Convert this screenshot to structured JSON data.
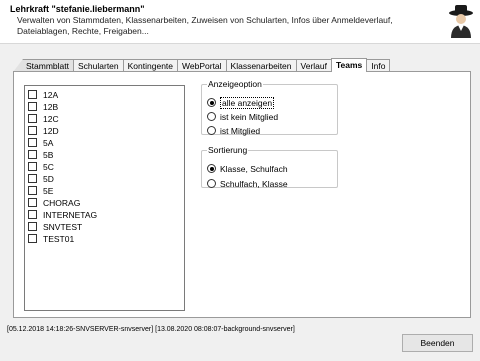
{
  "header": {
    "title": "Lehrkraft \"stefanie.liebermann\"",
    "description": "Verwalten von Stammdaten, Klassenarbeiten, Zuweisen von Schularten, Infos über Anmeldeverlauf, Dateiablagen, Rechte, Freigaben..."
  },
  "tabs": [
    {
      "label": "Stammblatt"
    },
    {
      "label": "Schularten"
    },
    {
      "label": "Kontingente"
    },
    {
      "label": "WebPortal"
    },
    {
      "label": "Klassenarbeiten"
    },
    {
      "label": "Verlauf"
    },
    {
      "label": "Teams",
      "active": true
    },
    {
      "label": "Info"
    }
  ],
  "team_list": [
    {
      "label": "12A",
      "checked": false
    },
    {
      "label": "12B",
      "checked": false
    },
    {
      "label": "12C",
      "checked": false
    },
    {
      "label": "12D",
      "checked": false
    },
    {
      "label": "5A",
      "checked": false
    },
    {
      "label": "5B",
      "checked": false
    },
    {
      "label": "5C",
      "checked": false
    },
    {
      "label": "5D",
      "checked": false
    },
    {
      "label": "5E",
      "checked": false
    },
    {
      "label": "CHORAG",
      "checked": false
    },
    {
      "label": "INTERNETAG",
      "checked": false
    },
    {
      "label": "SNVTEST",
      "checked": false
    },
    {
      "label": "TEST01",
      "checked": false
    }
  ],
  "display_option": {
    "legend": "Anzeigeoption",
    "options": [
      {
        "label": "alle anzeigen",
        "selected": true
      },
      {
        "label": "ist kein Mitglied",
        "selected": false
      },
      {
        "label": "ist  Mitglied",
        "selected": false
      }
    ]
  },
  "sorting": {
    "legend": "Sortierung",
    "options": [
      {
        "label": "Klasse, Schulfach",
        "selected": true
      },
      {
        "label": "Schulfach, Klasse",
        "selected": false
      }
    ]
  },
  "status_text": "[05.12.2018 14:18:26-SNVSERVER-snvserver] [13.08.2020 08:08:07-background-snvserver]",
  "close_button_label": "Beenden"
}
